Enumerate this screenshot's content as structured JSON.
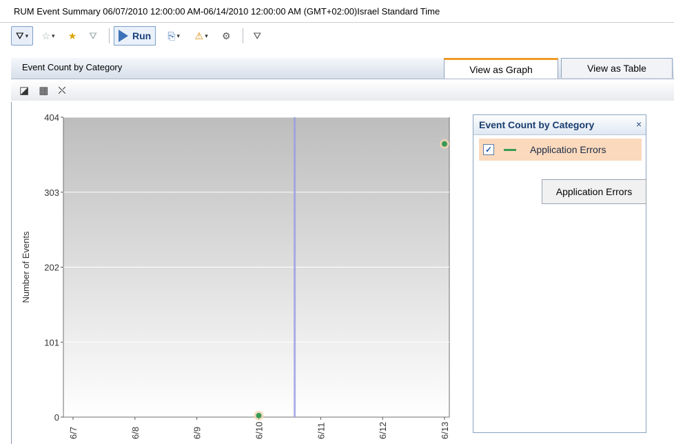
{
  "window": {
    "title": "RUM Event Summary 06/07/2010 12:00:00 AM-06/14/2010 12:00:00 AM (GMT+02:00)Israel Standard Time"
  },
  "toolbar": {
    "run_label": "Run"
  },
  "panel": {
    "title": "Event Count by Category"
  },
  "tabs": [
    {
      "label": "View as Graph",
      "active": true
    },
    {
      "label": "View as Table",
      "active": false
    }
  ],
  "legend": {
    "title": "Event Count by Category",
    "close": "×",
    "items": [
      {
        "label": "Application Errors",
        "checked": true,
        "check": "✓"
      }
    ]
  },
  "tooltip": {
    "text": "Application Errors"
  },
  "colors": {
    "series": "#3a9a55",
    "selection": "#f09a22"
  },
  "chart_data": {
    "type": "scatter",
    "title": "",
    "xlabel": "",
    "ylabel": "Number of Events",
    "x_ticks": [
      "6/7",
      "6/8",
      "6/9",
      "6/10",
      "6/11",
      "6/12",
      "6/13"
    ],
    "y_ticks": [
      0,
      101,
      202,
      303,
      404
    ],
    "ylim": [
      0,
      404
    ],
    "series": [
      {
        "name": "Application Errors",
        "points": [
          {
            "x": "6/10",
            "y": 2
          },
          {
            "x": "6/13",
            "y": 368
          }
        ]
      }
    ],
    "vertical_marker": {
      "x_position_between": [
        "6/10",
        "6/11"
      ],
      "fraction": 0.58
    },
    "grid": true
  }
}
